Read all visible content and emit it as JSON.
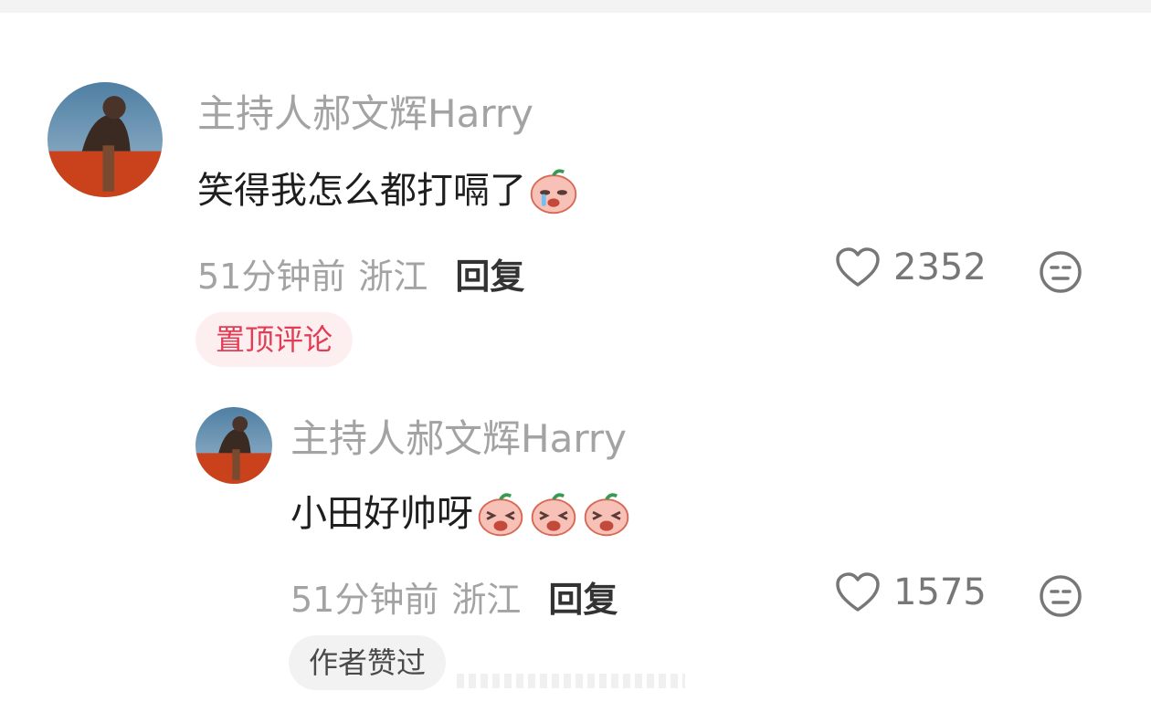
{
  "comments": [
    {
      "username": "主持人郝文辉Harry",
      "text": "笑得我怎么都打嗝了",
      "emoji": "crying-laugh-peach-emoji",
      "time": "51分钟前",
      "region": "浙江",
      "reply_label": "回复",
      "likes": "2352",
      "badge": "置顶评论"
    },
    {
      "username": "主持人郝文辉Harry",
      "text": "小田好帅呀",
      "emoji": "excited-peach-emoji",
      "time": "51分钟前",
      "region": "浙江",
      "reply_label": "回复",
      "likes": "1575",
      "badge": "作者赞过"
    }
  ],
  "colors": {
    "pinned_badge_text": "#e23d55",
    "pinned_badge_bg": "#fdeef0",
    "muted_text": "#a3a3a3"
  },
  "icons": [
    "heart-icon",
    "dislike-face-icon"
  ]
}
